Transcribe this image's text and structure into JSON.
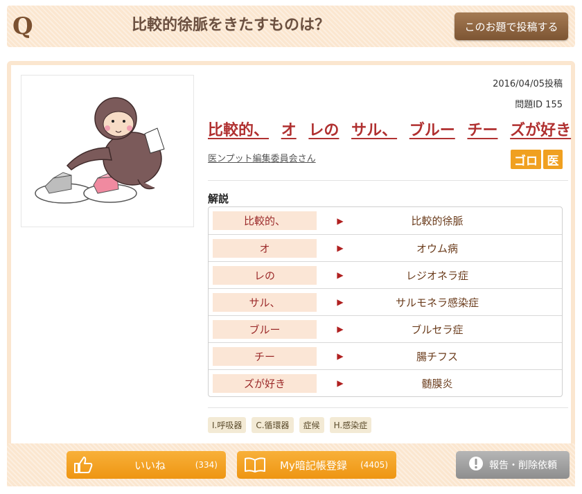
{
  "header": {
    "q_letter": "Q",
    "title": "比較的徐脈をきたすものは？",
    "post_button": "このお題で投稿する"
  },
  "post": {
    "date": "2016/04/05投稿",
    "problem_id": "問題ID 155",
    "mnemonic": [
      "比較的、",
      "オ",
      "レの",
      "サル、",
      "ブルー",
      "チー",
      "ズが好き"
    ],
    "author": "医ンプット編集委員会さん",
    "badges": [
      "ゴロ",
      "医"
    ],
    "illustration_label": "オレのサル"
  },
  "explanation": {
    "title": "解説",
    "rows": [
      {
        "key": "比較的、",
        "value": "比較的徐脈"
      },
      {
        "key": "オ",
        "value": "オウム病"
      },
      {
        "key": "レの",
        "value": "レジオネラ症"
      },
      {
        "key": "サル、",
        "value": "サルモネラ感染症"
      },
      {
        "key": "ブルー",
        "value": "ブルセラ症"
      },
      {
        "key": "チー",
        "value": "腸チフス"
      },
      {
        "key": "ズが好き",
        "value": "髄膜炎"
      }
    ]
  },
  "tags": [
    "I.呼吸器",
    "C.循環器",
    "症候",
    "H.感染症"
  ],
  "actions": {
    "like_label": "いいね",
    "like_count": "(334)",
    "my_label": "My暗記帳登録",
    "my_count": "(4405)",
    "report_label": "報告・削除依頼"
  },
  "colors": {
    "accent": "#f0a020",
    "header_bg": "#fbe6cf",
    "mnemonic": "#b03030",
    "post_button": "#8a6240"
  },
  "icons": [
    "thumbs-up-icon",
    "book-icon",
    "exclamation-icon"
  ]
}
